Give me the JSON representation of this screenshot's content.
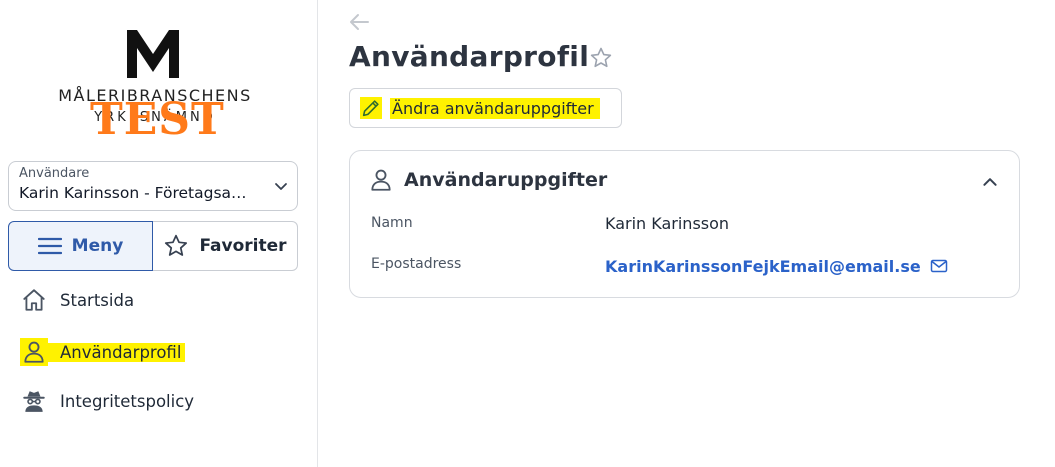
{
  "logo": {
    "brand": "MÅLERIBRANSCHENS",
    "sub": "YRKESNÄMND",
    "stamp": "TEST"
  },
  "sidebar": {
    "user_select": {
      "label": "Användare",
      "value": "Karin Karinsson - Företagsa…"
    },
    "tabs": [
      {
        "label": "Meny",
        "icon": "hamburger-icon"
      },
      {
        "label": "Favoriter",
        "icon": "star-icon"
      }
    ],
    "items": [
      {
        "label": "Startsida",
        "icon": "home-icon"
      },
      {
        "label": "Användarprofil",
        "icon": "user-icon",
        "active": true
      },
      {
        "label": "Integritetspolicy",
        "icon": "spy-icon"
      }
    ]
  },
  "main": {
    "title": "Användarprofil",
    "edit_button": "Ändra användaruppgifter",
    "card": {
      "title": "Användaruppgifter",
      "rows": [
        {
          "label": "Namn",
          "value": "Karin Karinsson"
        },
        {
          "label": "E-postadress",
          "value": "KarinKarinssonFejkEmail@email.se"
        }
      ]
    }
  },
  "colors": {
    "accent": "#2f5aa8",
    "link": "#2b62c9",
    "highlight": "#fff200",
    "stamp": "#ff7a1a"
  }
}
